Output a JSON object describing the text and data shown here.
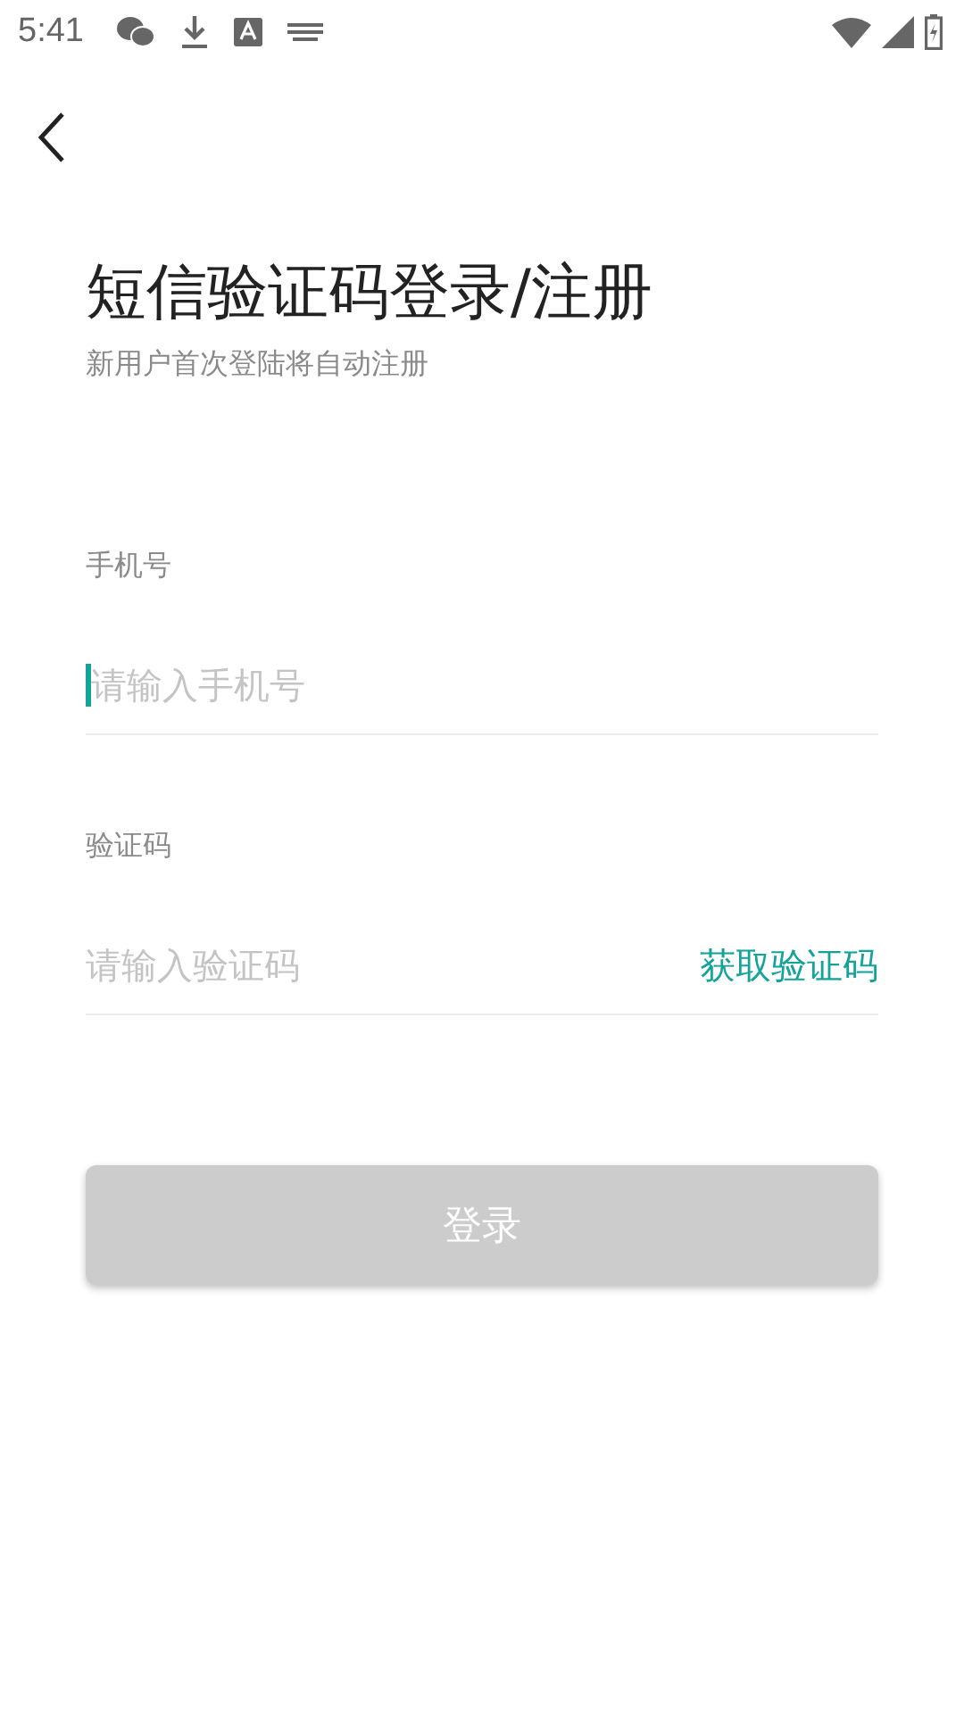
{
  "status_bar": {
    "time": "5:41"
  },
  "title": "短信验证码登录/注册",
  "subtitle": "新用户首次登陆将自动注册",
  "fields": [
    {
      "label": "手机号",
      "placeholder": "请输入手机号",
      "focused": true
    },
    {
      "label": "验证码",
      "placeholder": "请输入验证码",
      "focused": false,
      "action": "获取验证码"
    }
  ],
  "login_button": {
    "label": "登录",
    "disabled": true
  }
}
